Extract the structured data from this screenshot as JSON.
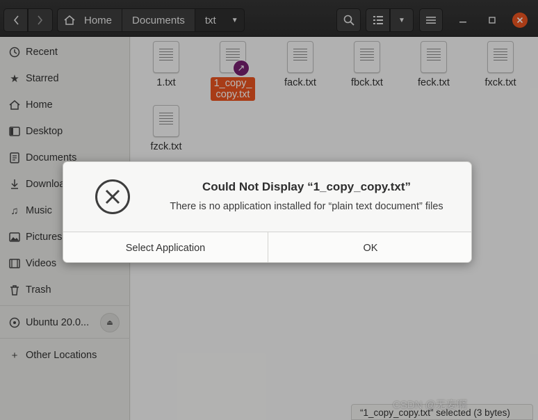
{
  "headerbar": {
    "breadcrumbs": [
      "Home",
      "Documents",
      "txt"
    ]
  },
  "sidebar": {
    "items": [
      {
        "label": "Recent",
        "icon": "clock-icon"
      },
      {
        "label": "Starred",
        "icon": "star-icon"
      },
      {
        "label": "Home",
        "icon": "home-icon"
      },
      {
        "label": "Desktop",
        "icon": "desktop-icon"
      },
      {
        "label": "Documents",
        "icon": "documents-icon"
      },
      {
        "label": "Downloads",
        "icon": "download-icon"
      },
      {
        "label": "Music",
        "icon": "music-icon"
      },
      {
        "label": "Pictures",
        "icon": "pictures-icon"
      },
      {
        "label": "Videos",
        "icon": "videos-icon"
      },
      {
        "label": "Trash",
        "icon": "trash-icon"
      }
    ],
    "devices": [
      {
        "label": "Ubuntu 20.0...",
        "icon": "disk-icon"
      }
    ],
    "other": {
      "label": "Other Locations",
      "icon": "plus-icon"
    }
  },
  "files": [
    {
      "name": "1.txt",
      "selected": false
    },
    {
      "name": "1_copy_copy.txt",
      "line1": "1_copy_",
      "line2": "copy.txt",
      "selected": true,
      "symlink": true
    },
    {
      "name": "fack.txt",
      "selected": false
    },
    {
      "name": "fbck.txt",
      "selected": false
    },
    {
      "name": "feck.txt",
      "selected": false
    },
    {
      "name": "fxck.txt",
      "selected": false
    },
    {
      "name": "fzck.txt",
      "selected": false
    }
  ],
  "dialog": {
    "title": "Could Not Display “1_copy_copy.txt”",
    "message": "There is no application installed for “plain text document” files",
    "buttons": [
      "Select Application",
      "OK"
    ]
  },
  "status": "“1_copy_copy.txt” selected (3 bytes)",
  "watermark": "CSDN @无妄啊",
  "colors": {
    "accent": "#e95420",
    "symlink": "#77216f"
  }
}
